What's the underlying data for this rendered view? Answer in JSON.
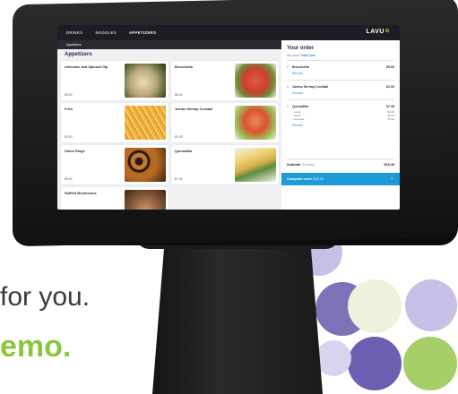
{
  "colors": {
    "accent_green": "#8cc63f",
    "accent_blue": "#1e9bd7",
    "nav_dark": "#1d1d24",
    "circle_purple": "#7c72b8",
    "circle_lavender": "#c6c0e6",
    "circle_cream": "#eef1dc",
    "circle_green": "#a6cf6a"
  },
  "marketing": {
    "tagline": "for you.",
    "cta": "emo."
  },
  "app": {
    "logo": "LAVU",
    "nav_tabs": [
      "DRINKS",
      "NOODLES",
      "APPETIZERS"
    ],
    "active_tab": "APPETIZERS",
    "breadcrumb": "Appetizers",
    "section_title": "Appetizers",
    "menu_items": [
      {
        "name": "Artichoke and Spinach Dip",
        "price": "$5.00",
        "icon": "spinach-dip-image",
        "color": "#b9a779"
      },
      {
        "name": "Bruschetta",
        "price": "$5.00",
        "icon": "bruschetta-image",
        "color": "#c9402f"
      },
      {
        "name": "Fries",
        "price": "$3.00",
        "icon": "fries-image",
        "color": "#e39b2a"
      },
      {
        "name": "Jumbo Shrimp Cocktail",
        "price": "$1.00",
        "icon": "shrimp-image",
        "color": "#d9532e"
      },
      {
        "name": "Onion Rings",
        "price": "$5.00",
        "icon": "onion-rings-image",
        "color": "#b76a22"
      },
      {
        "name": "Quesadilla",
        "price": "$7.00",
        "icon": "quesadilla-image",
        "color": "#d8b24a"
      },
      {
        "name": "Stuffed Mushrooms",
        "price": "",
        "icon": "mushrooms-image",
        "color": "#8a5a3a"
      }
    ]
  },
  "order": {
    "title": "Your order",
    "guest_prompt": "Not yours?",
    "guest_link": "Start Over",
    "lines": [
      {
        "qty": "1",
        "name": "Bruschetta",
        "price": "$5.00",
        "remove": "Remove",
        "mods": []
      },
      {
        "qty": "1",
        "name": "Jumbo Shrimp Cocktail",
        "price": "$1.00",
        "remove": "Remove",
        "mods": []
      },
      {
        "qty": "1",
        "name": "Quesadilla",
        "price": "$7.95",
        "remove": "Remove",
        "mods": [
          {
            "label": "- Large",
            "price": "$0.00"
          },
          {
            "label": "- Steak",
            "price": "$3.00"
          },
          {
            "label": "- Avocado",
            "price": "$1.50"
          }
        ]
      }
    ],
    "subtotal_label": "Subtotal",
    "subtotal_count": "(3 items)",
    "subtotal_value": "$18.45",
    "complete_label": "Complete order",
    "complete_amount": "$18.45",
    "complete_chevron": "›"
  }
}
